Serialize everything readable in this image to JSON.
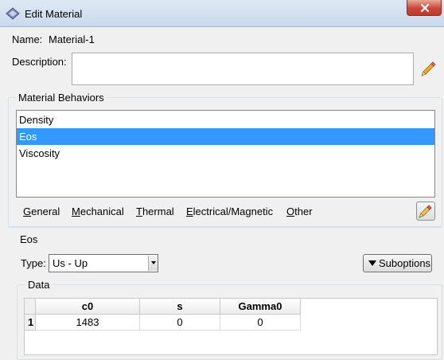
{
  "window": {
    "title": "Edit Material"
  },
  "name": {
    "label": "Name:",
    "value": "Material-1"
  },
  "description": {
    "label": "Description:",
    "value": ""
  },
  "behaviors": {
    "title": "Material Behaviors",
    "items": [
      {
        "label": "Density",
        "selected": false
      },
      {
        "label": "Eos",
        "selected": true
      },
      {
        "label": "Viscosity",
        "selected": false
      }
    ],
    "menus": [
      {
        "underline": "G",
        "rest": "eneral"
      },
      {
        "underline": "M",
        "rest": "echanical"
      },
      {
        "underline": "T",
        "rest": "hermal"
      },
      {
        "underline": "E",
        "rest": "lectrical/Magnetic"
      },
      {
        "underline": "O",
        "rest": "ther"
      }
    ]
  },
  "eos": {
    "title": "Eos",
    "type_label": "Type:",
    "type_value": "Us - Up",
    "suboptions_label": "Suboptions"
  },
  "data": {
    "title": "Data",
    "columns": [
      "c0",
      "s",
      "Gamma0"
    ],
    "rows": [
      {
        "index": "1",
        "cells": [
          "1483",
          "0",
          "0"
        ]
      }
    ]
  },
  "colors": {
    "selection": "#3399ff",
    "titlebar": "#dfe9f5",
    "close": "#c9463a"
  },
  "icons": [
    "app-icon",
    "close-icon",
    "pencil-icon",
    "edit-icon",
    "dropdown-arrow-icon",
    "triangle-down-icon"
  ]
}
